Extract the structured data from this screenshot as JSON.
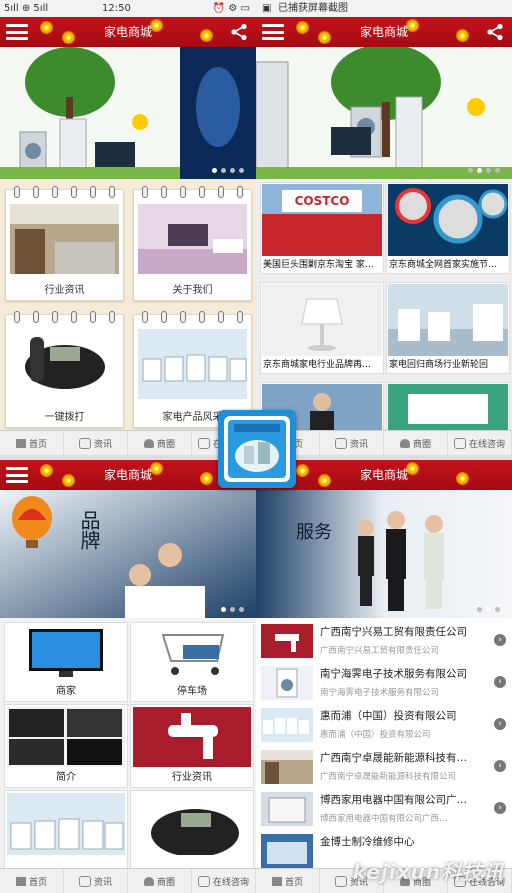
{
  "status_left": {
    "signal": "5ıll ⊕ 5ıll",
    "time": "12:50"
  },
  "status_right": {
    "text": "已捕获屏幕截图"
  },
  "app": {
    "title": "家电商城"
  },
  "tabs": [
    {
      "label": "首页",
      "icon": "home-icon"
    },
    {
      "label": "资讯",
      "icon": "chat-icon"
    },
    {
      "label": "商圈",
      "icon": "person-icon"
    },
    {
      "label": "在线咨询",
      "icon": "chat-icon"
    }
  ],
  "q1": {
    "cards": [
      {
        "label": "行业资讯",
        "image": "kitchen-photo"
      },
      {
        "label": "关于我们",
        "image": "living-room-photo"
      },
      {
        "label": "一键拨打",
        "image": "telephone-photo"
      },
      {
        "label": "家电产品风采",
        "image": "washing-machines-photo"
      }
    ]
  },
  "q2": {
    "tiles": [
      {
        "label": "美国巨头围剿京东淘宝 家…",
        "image": "costco-store-photo"
      },
      {
        "label": "京东商城全网首家实施节…",
        "image": "speakers-photo"
      },
      {
        "label": "京东商城家电行业品牌再…",
        "image": "lamp-photo"
      },
      {
        "label": "家电回归商场行业新轮回",
        "image": "mall-photo"
      }
    ]
  },
  "q3": {
    "banner_text": "品牌",
    "tiles": [
      {
        "label": "商家",
        "image": "tv-photo"
      },
      {
        "label": "停车场",
        "image": "shopping-cart-photo"
      },
      {
        "label": "简介",
        "image": "laptops-photo"
      },
      {
        "label": "行业资讯",
        "image": "faucet-photo"
      }
    ]
  },
  "q4": {
    "banner_text": "服务",
    "companies": [
      {
        "name": "广西南宁兴易工贸有限责任公司",
        "sub": "广西南宁兴易工贸有限责任公司",
        "image": "faucet-photo"
      },
      {
        "name": "南宁海霁电子技术服务有限公司",
        "sub": "南宁海霁电子技术服务有限公司",
        "image": "washing-machine-photo"
      },
      {
        "name": "惠而浦（中国）投资有限公司",
        "sub": "惠而浦（中国）投资有限公司",
        "image": "washers-row-photo"
      },
      {
        "name": "广西南宁卓晟能新能源科技有…",
        "sub": "广西南宁卓晟能新能源科技有限公司",
        "image": "kitchen-photo"
      },
      {
        "name": "博西家用电器中国有限公司广…",
        "sub": "博西家用电器中国有限公司广西…",
        "image": "appliance-photo"
      },
      {
        "name": "金博士制冷维修中心",
        "sub": "",
        "image": "storefront-photo"
      }
    ]
  },
  "watermark": "kejixun科技讯",
  "colors": {
    "titlebar": "#b8101a",
    "accent": "#c4121b"
  }
}
